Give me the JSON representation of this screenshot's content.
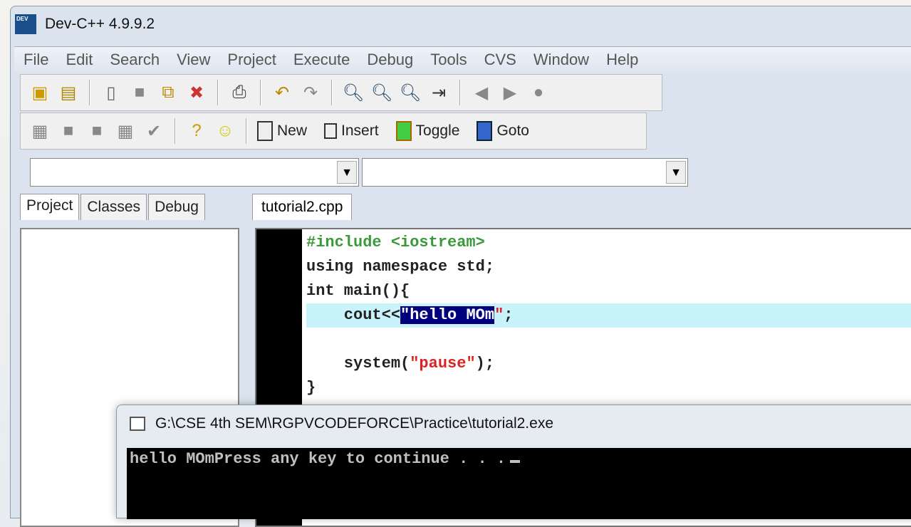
{
  "window": {
    "title": "Dev-C++ 4.9.9.2",
    "icon_text": "DEV"
  },
  "menu": [
    "File",
    "Edit",
    "Search",
    "View",
    "Project",
    "Execute",
    "Debug",
    "Tools",
    "CVS",
    "Window",
    "Help"
  ],
  "toolbar2": {
    "new": "New",
    "insert": "Insert",
    "toggle": "Toggle",
    "goto": "Goto"
  },
  "left_tabs": [
    "Project",
    "Classes",
    "Debug"
  ],
  "editor": {
    "tab": "tutorial2.cpp",
    "lines": {
      "l1": "#include <iostream>",
      "l2": "using namespace std;",
      "l3": "int main(){",
      "l4a": "    cout<<",
      "l4b": "\"hello MOm",
      "l4c": "\"",
      "l4d": ";",
      "l6a": "    system(",
      "l6b": "\"pause\"",
      "l6c": ");",
      "l7": "}"
    }
  },
  "console": {
    "title": "G:\\CSE 4th SEM\\RGPVCODEFORCE\\Practice\\tutorial2.exe",
    "output": "hello MOmPress any key to continue . . ."
  }
}
